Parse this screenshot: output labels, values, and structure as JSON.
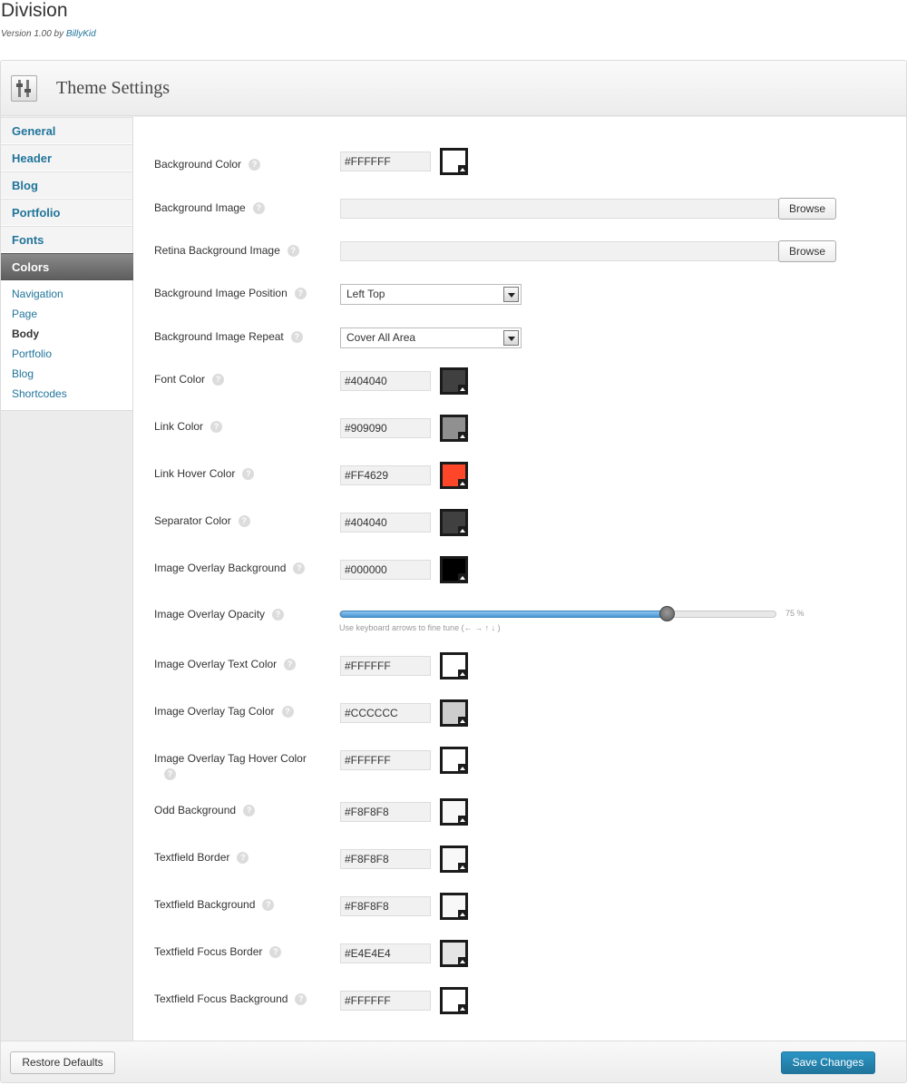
{
  "theme": {
    "name": "Division",
    "version_prefix": "Version 1.00 by",
    "author": "BillyKid"
  },
  "panel": {
    "title": "Theme Settings"
  },
  "sidebar": {
    "items": [
      {
        "label": "General"
      },
      {
        "label": "Header"
      },
      {
        "label": "Blog"
      },
      {
        "label": "Portfolio"
      },
      {
        "label": "Fonts"
      },
      {
        "label": "Colors"
      }
    ],
    "active": "Colors",
    "subitems": [
      {
        "label": "Navigation"
      },
      {
        "label": "Page"
      },
      {
        "label": "Body"
      },
      {
        "label": "Portfolio"
      },
      {
        "label": "Blog"
      },
      {
        "label": "Shortcodes"
      }
    ],
    "current_subitem": "Body"
  },
  "help_icon": "question-mark-icon",
  "fields": {
    "background_color": {
      "label": "Background Color",
      "value": "#FFFFFF",
      "swatch": "#FFFFFF"
    },
    "background_image": {
      "label": "Background Image",
      "value": "",
      "button": "Browse"
    },
    "retina_background_image": {
      "label": "Retina Background Image",
      "value": "",
      "button": "Browse"
    },
    "background_image_position": {
      "label": "Background Image Position",
      "value": "Left Top"
    },
    "background_image_repeat": {
      "label": "Background Image Repeat",
      "value": "Cover All Area"
    },
    "font_color": {
      "label": "Font Color",
      "value": "#404040",
      "swatch": "#404040"
    },
    "link_color": {
      "label": "Link Color",
      "value": "#909090",
      "swatch": "#909090"
    },
    "link_hover_color": {
      "label": "Link Hover Color",
      "value": "#FF4629",
      "swatch": "#FF4629"
    },
    "separator_color": {
      "label": "Separator Color",
      "value": "#404040",
      "swatch": "#404040"
    },
    "image_overlay_background": {
      "label": "Image Overlay Background",
      "value": "#000000",
      "swatch": "#000000"
    },
    "image_overlay_opacity": {
      "label": "Image Overlay Opacity",
      "value": 75,
      "value_text": "75 %",
      "hint": "Use keyboard arrows to fine tune (← → ↑ ↓ )"
    },
    "image_overlay_text_color": {
      "label": "Image Overlay Text Color",
      "value": "#FFFFFF",
      "swatch": "#FFFFFF"
    },
    "image_overlay_tag_color": {
      "label": "Image Overlay Tag Color",
      "value": "#CCCCCC",
      "swatch": "#CCCCCC"
    },
    "image_overlay_tag_hover_color": {
      "label": "Image Overlay Tag Hover Color",
      "value": "#FFFFFF",
      "swatch": "#FFFFFF"
    },
    "odd_background": {
      "label": "Odd Background",
      "value": "#F8F8F8",
      "swatch": "#F8F8F8"
    },
    "textfield_border": {
      "label": "Textfield Border",
      "value": "#F8F8F8",
      "swatch": "#F8F8F8"
    },
    "textfield_background": {
      "label": "Textfield Background",
      "value": "#F8F8F8",
      "swatch": "#F8F8F8"
    },
    "textfield_focus_border": {
      "label": "Textfield Focus Border",
      "value": "#E4E4E4",
      "swatch": "#E4E4E4"
    },
    "textfield_focus_background": {
      "label": "Textfield Focus Background",
      "value": "#FFFFFF",
      "swatch": "#FFFFFF"
    }
  },
  "footer": {
    "restore_label": "Restore Defaults",
    "save_label": "Save Changes"
  },
  "colors": {
    "link": "#21759b",
    "primary_button": "#21759b",
    "active_nav": "#6a6a6a"
  }
}
